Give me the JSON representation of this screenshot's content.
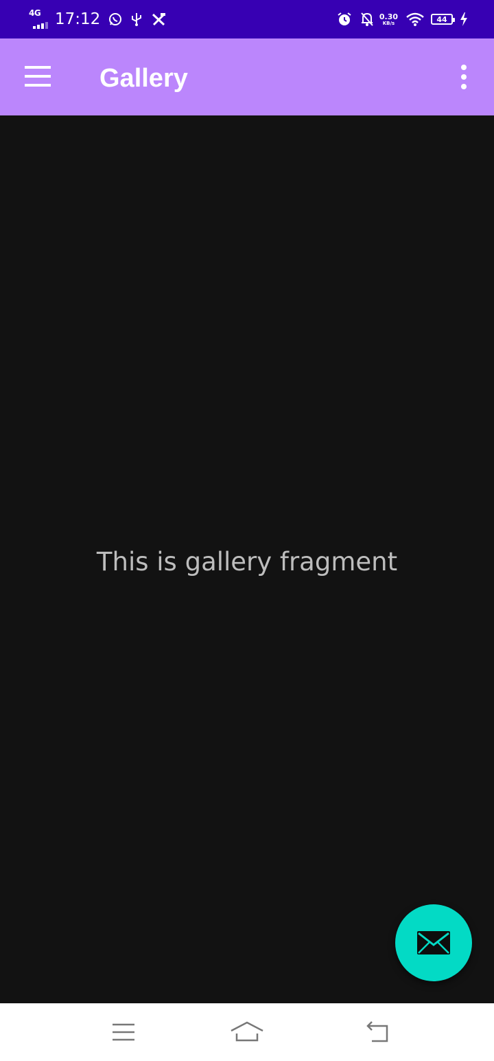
{
  "status_bar": {
    "network_type": "4G",
    "time": "17:12",
    "net_speed_value": "0.30",
    "net_speed_unit": "KB/s",
    "battery_level": "44",
    "icons_left": [
      "whatsapp-icon",
      "usb-icon",
      "tools-icon"
    ],
    "icons_right": [
      "alarm-icon",
      "notifications-off-icon",
      "wifi-icon",
      "battery-icon",
      "charging-icon"
    ]
  },
  "app_bar": {
    "title": "Gallery",
    "menu_icon": "hamburger-menu-icon",
    "overflow_icon": "more-vertical-icon",
    "background": "#bb86fc"
  },
  "content": {
    "message": "This is gallery fragment",
    "background": "#121212"
  },
  "fab": {
    "icon": "email-icon",
    "background": "#03dac5"
  },
  "nav_bar": {
    "buttons": [
      "recents-menu-icon",
      "home-icon",
      "back-icon"
    ]
  }
}
